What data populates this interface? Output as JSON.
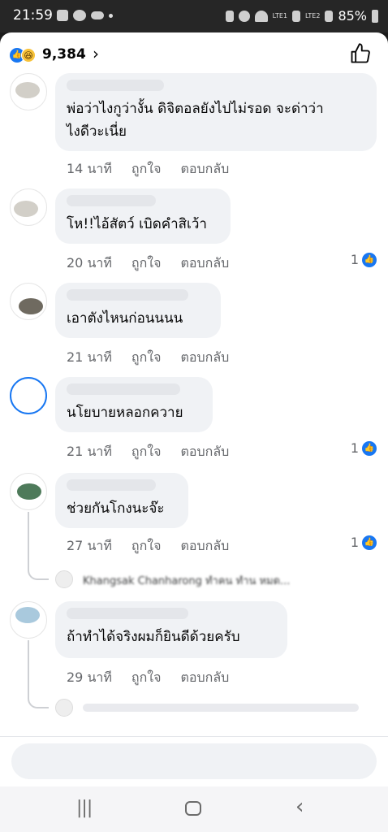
{
  "status_bar": {
    "time": "21:59",
    "network_1": "LTE1",
    "network_2": "LTE2",
    "battery": "85%"
  },
  "reactions": {
    "count": "9,384"
  },
  "comments": [
    {
      "text_line1": "พ่อว่าไงกูว่างั้น ดิจิตอลยังไปไม่รอด จะด่าว่า",
      "text_line2": "ไงดีวะเนี่ย",
      "time": "14 นาที",
      "like": "ถูกใจ",
      "reply": "ตอบกลับ",
      "likes": ""
    },
    {
      "text_line1": "โห!!ไอ้สัตว์ เบิดคำสิเว้า",
      "time": "20 นาที",
      "like": "ถูกใจ",
      "reply": "ตอบกลับ",
      "likes": "1"
    },
    {
      "text_line1": "เอาตังไหนก่อนนนน",
      "time": "21 นาที",
      "like": "ถูกใจ",
      "reply": "ตอบกลับ",
      "likes": ""
    },
    {
      "text_line1": "นโยบายหลอกควาย",
      "time": "21 นาที",
      "like": "ถูกใจ",
      "reply": "ตอบกลับ",
      "likes": "1"
    },
    {
      "text_line1": "ช่วยกันโกงนะจ๊ะ",
      "time": "27 นาที",
      "like": "ถูกใจ",
      "reply": "ตอบกลับ",
      "likes": "1"
    },
    {
      "text_line1": "ถ้าทำได้จริงผมก็ยินดีด้วยครับ",
      "time": "29 นาที",
      "like": "ถูกใจ",
      "reply": "ตอบกลับ",
      "likes": ""
    }
  ],
  "reply_previews": [
    {
      "text": "Khangsak Chanharong ทำคน ทำน หมด..."
    }
  ],
  "colors": {
    "accent": "#1877f2",
    "bubble": "#f0f2f5",
    "meta": "#65676b"
  },
  "icons": [
    "like-reaction-icon",
    "haha-reaction-icon",
    "thumbs-up-icon",
    "chevron-right-icon",
    "recents-icon",
    "home-icon",
    "back-icon"
  ]
}
